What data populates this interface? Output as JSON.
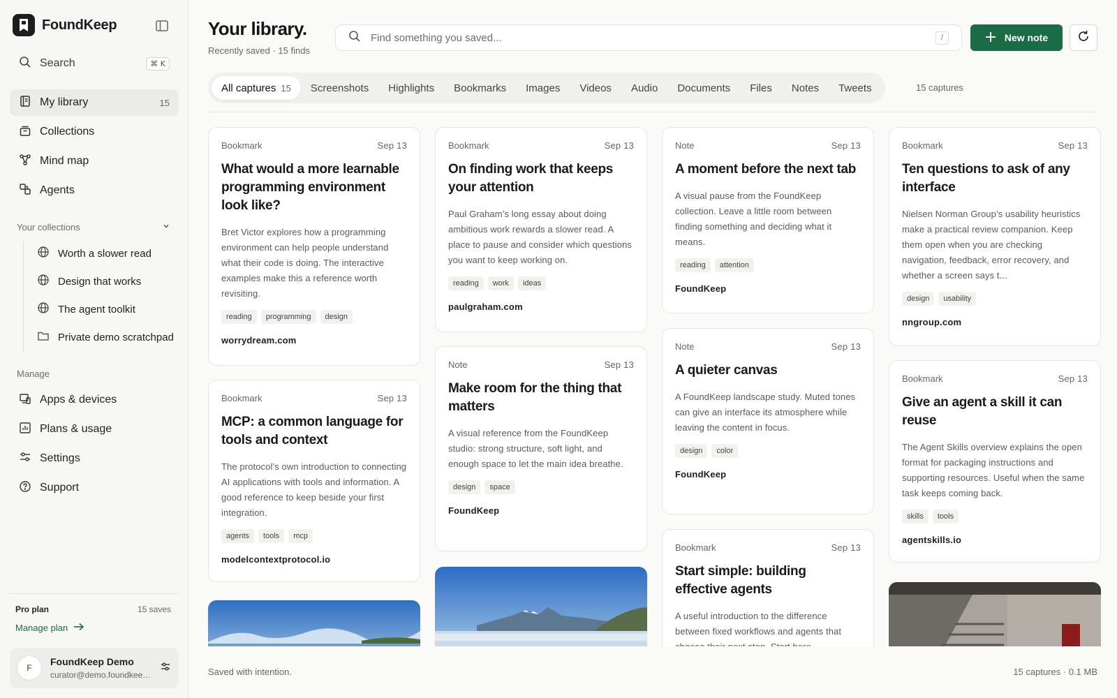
{
  "app": {
    "name": "FoundKeep"
  },
  "sidebar": {
    "search_label": "Search",
    "search_shortcut": "⌘ K",
    "nav": [
      {
        "label": "My library",
        "count": "15",
        "icon": "library-icon"
      },
      {
        "label": "Collections",
        "icon": "collections-icon"
      },
      {
        "label": "Mind map",
        "icon": "mind-map-icon"
      },
      {
        "label": "Agents",
        "icon": "agents-icon"
      }
    ],
    "collections_heading": "Your collections",
    "collections": [
      {
        "label": "Worth a slower read",
        "icon": "globe-icon"
      },
      {
        "label": "Design that works",
        "icon": "globe-icon"
      },
      {
        "label": "The agent toolkit",
        "icon": "globe-icon"
      },
      {
        "label": "Private demo scratchpad",
        "icon": "folder-icon"
      }
    ],
    "manage_heading": "Manage",
    "manage": [
      {
        "label": "Apps & devices",
        "icon": "devices-icon"
      },
      {
        "label": "Plans & usage",
        "icon": "chart-icon"
      },
      {
        "label": "Settings",
        "icon": "sliders-icon"
      },
      {
        "label": "Support",
        "icon": "help-icon"
      }
    ],
    "plan": {
      "name": "Pro plan",
      "saves": "15 saves",
      "manage_label": "Manage plan"
    },
    "user": {
      "initial": "F",
      "name": "FoundKeep Demo",
      "email": "curator@demo.foundkeep.app"
    }
  },
  "header": {
    "title": "Your library.",
    "subtitle": "Recently saved · 15 finds",
    "search_placeholder": "Find something you saved...",
    "search_shortcut": "/",
    "new_note_label": "New note"
  },
  "tabs": [
    {
      "label": "All captures",
      "count": "15"
    },
    {
      "label": "Screenshots"
    },
    {
      "label": "Highlights"
    },
    {
      "label": "Bookmarks"
    },
    {
      "label": "Images"
    },
    {
      "label": "Videos"
    },
    {
      "label": "Audio"
    },
    {
      "label": "Documents"
    },
    {
      "label": "Files"
    },
    {
      "label": "Notes"
    },
    {
      "label": "Tweets"
    }
  ],
  "captures_count": "15 captures",
  "cards": [
    {
      "type": "Bookmark",
      "date": "Sep 13",
      "title": "What would a more learnable programming environment look like?",
      "desc": "Bret Victor explores how a programming environment can help people understand what their code is doing. The interactive examples make this a reference worth revisiting.",
      "tags": [
        "reading",
        "programming",
        "design"
      ],
      "source": "worrydream.com"
    },
    {
      "type": "Bookmark",
      "date": "Sep 13",
      "title": "MCP: a common language for tools and context",
      "desc": "The protocol’s own introduction to connecting AI applications with tools and information. A good reference to keep beside your first integration.",
      "tags": [
        "agents",
        "tools",
        "mcp"
      ],
      "source": "modelcontextprotocol.io"
    },
    {
      "type": "Bookmark",
      "date": "Sep 13",
      "title": "On finding work that keeps your attention",
      "desc": "Paul Graham’s long essay about doing ambitious work rewards a slower read. A place to pause and consider which questions you want to keep working on.",
      "tags": [
        "reading",
        "work",
        "ideas"
      ],
      "source": "paulgraham.com"
    },
    {
      "type": "Note",
      "date": "Sep 13",
      "title": "Make room for the thing that matters",
      "desc": "A visual reference from the FoundKeep studio: strong structure, soft light, and enough space to let the main idea breathe.",
      "tags": [
        "design",
        "space"
      ],
      "source": "FoundKeep"
    },
    {
      "type": "Note",
      "date": "Sep 13",
      "title": "A moment before the next tab",
      "desc": "A visual pause from the FoundKeep collection. Leave a little room between finding something and deciding what it means.",
      "tags": [
        "reading",
        "attention"
      ],
      "source": "FoundKeep"
    },
    {
      "type": "Note",
      "date": "Sep 13",
      "title": "A quieter canvas",
      "desc": "A FoundKeep landscape study. Muted tones can give an interface its atmosphere while leaving the content in focus.",
      "tags": [
        "design",
        "color"
      ],
      "source": "FoundKeep"
    },
    {
      "type": "Bookmark",
      "date": "Sep 13",
      "title": "Start simple: building effective agents",
      "desc": "A useful introduction to the difference between fixed workflows and agents that choose their next step. Start here.",
      "tags": [],
      "source": ""
    },
    {
      "type": "Bookmark",
      "date": "Sep 13",
      "title": "Ten questions to ask of any interface",
      "desc": "Nielsen Norman Group’s usability heuristics make a practical review companion. Keep them open when you are checking navigation, feedback, error recovery, and whether a screen says t...",
      "tags": [
        "design",
        "usability"
      ],
      "source": "nngroup.com"
    },
    {
      "type": "Bookmark",
      "date": "Sep 13",
      "title": "Give an agent a skill it can reuse",
      "desc": "The Agent Skills overview explains the open format for packaging instructions and supporting resources. Useful when the same task keeps coming back.",
      "tags": [
        "skills",
        "tools"
      ],
      "source": "agentskills.io"
    }
  ],
  "footer": {
    "left": "Saved with intention.",
    "right": "15 captures · 0.1 MB"
  },
  "colors": {
    "accent": "#1a6b46",
    "text": "#1c1c1c",
    "muted": "#666666"
  }
}
